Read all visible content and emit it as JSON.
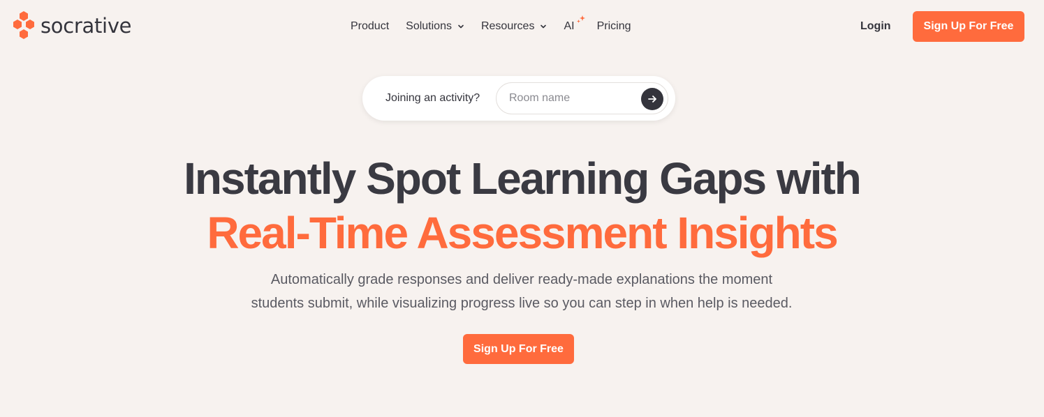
{
  "brand": {
    "name": "socrative",
    "accent_color": "#ff6b3d",
    "text_color": "#34343c"
  },
  "nav": {
    "items": [
      {
        "label": "Product",
        "has_dropdown": false
      },
      {
        "label": "Solutions",
        "has_dropdown": true
      },
      {
        "label": "Resources",
        "has_dropdown": true
      },
      {
        "label": "AI",
        "has_dropdown": false,
        "icon": "sparkle-icon"
      },
      {
        "label": "Pricing",
        "has_dropdown": false
      }
    ],
    "login_label": "Login",
    "signup_label": "Sign Up For Free"
  },
  "join": {
    "label": "Joining an activity?",
    "room_placeholder": "Room name",
    "room_value": "",
    "submit_icon": "arrow-right-icon"
  },
  "hero": {
    "headline_line1": "Instantly Spot Learning Gaps with",
    "headline_line2": "Real-Time Assessment Insights",
    "subtext_line1": "Automatically grade responses and deliver ready-made explanations the moment",
    "subtext_line2": "students submit, while visualizing progress live so you can step in when help is needed.",
    "cta_label": "Sign Up For Free"
  }
}
